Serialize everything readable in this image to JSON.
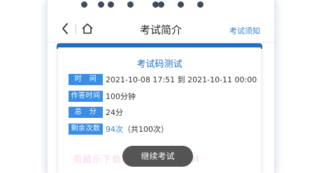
{
  "header": {
    "title": "考试简介",
    "right_link": "考试须知"
  },
  "exam": {
    "title": "考试码测试",
    "rows": [
      {
        "label": "时　间",
        "value": "2021-10-08 17:51 到 2021-10-11 00:00"
      },
      {
        "label": "作答时间",
        "value": "100分钟"
      },
      {
        "label": "总　分",
        "value": "24分"
      },
      {
        "label": "剩余次数",
        "value_highlight": "94次",
        "value_suffix": "（共100次）"
      }
    ]
  },
  "continue_button": "继续考试",
  "watermark": "需藏乐下载 … ALEDU.COM",
  "colors": {
    "accent": "#1a6fc6",
    "tag": "#3a8ee6",
    "link": "#2c82d4"
  },
  "icons": [
    "back-icon",
    "home-icon"
  ]
}
